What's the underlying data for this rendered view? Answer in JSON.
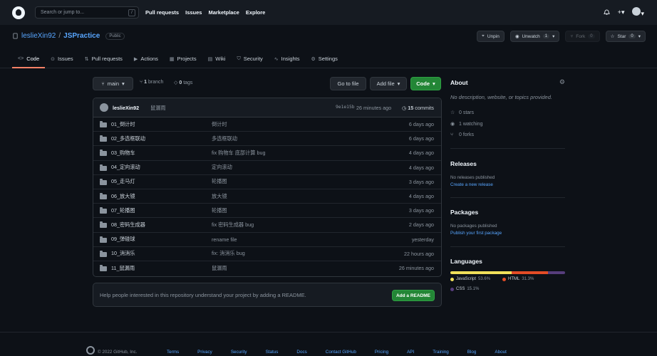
{
  "topbar": {
    "search_placeholder": "Search or jump to...",
    "search_key": "/",
    "nav": [
      "Pull requests",
      "Issues",
      "Marketplace",
      "Explore"
    ],
    "plus": "+",
    "chevron": "▾"
  },
  "repo": {
    "owner": "leslieXin92",
    "separator": "/",
    "name": "JSPractice",
    "visibility": "Public",
    "actions": {
      "unpin": "Unpin",
      "unwatch": "Unwatch",
      "unwatch_count": "1",
      "fork": "Fork",
      "fork_count": "0",
      "star": "Star",
      "star_count": "0"
    },
    "tabs": [
      "Code",
      "Issues",
      "Pull requests",
      "Actions",
      "Projects",
      "Wiki",
      "Security",
      "Insights",
      "Settings"
    ]
  },
  "controls": {
    "branch": "main",
    "branch_count": "1",
    "branch_label": "branch",
    "tags_count": "0",
    "tags_label": "tags",
    "go_to_file": "Go to file",
    "add_file": "Add file",
    "code": "Code"
  },
  "latest_commit": {
    "author": "leslieXin92",
    "message": "鼠漏雨",
    "hash": "9e1e15b",
    "time": "26 minutes ago",
    "commits_count": "15",
    "commits_label": "commits"
  },
  "files": [
    {
      "name": "01_倒计时",
      "message": "倒计时",
      "date": "6 days ago"
    },
    {
      "name": "02_多选框联动",
      "message": "多选框联动",
      "date": "6 days ago"
    },
    {
      "name": "03_购物车",
      "message": "fix 购物车 底部计算 bug",
      "date": "4 days ago"
    },
    {
      "name": "04_定向滚动",
      "message": "定向滚动",
      "date": "4 days ago"
    },
    {
      "name": "05_走马灯",
      "message": "轮播图",
      "date": "3 days ago"
    },
    {
      "name": "06_放大镜",
      "message": "放大镜",
      "date": "4 days ago"
    },
    {
      "name": "07_轮播图",
      "message": "轮播图",
      "date": "3 days ago"
    },
    {
      "name": "08_密码生成器",
      "message": "fix 密码生成器 bug",
      "date": "2 days ago"
    },
    {
      "name": "09_弹碰球",
      "message": "rename file",
      "date": "yesterday"
    },
    {
      "name": "10_消消乐",
      "message": "fix: 消消乐 bug",
      "date": "22 hours ago"
    },
    {
      "name": "11_鼠漏雨",
      "message": "鼠漏雨",
      "date": "26 minutes ago"
    }
  ],
  "readme": {
    "text": "Help people interested in this repository understand your project by adding a README.",
    "button": "Add a README"
  },
  "sidebar": {
    "about_title": "About",
    "description": "No description, website, or topics provided.",
    "stars": "0 stars",
    "watching": "1 watching",
    "forks": "0 forks",
    "releases_title": "Releases",
    "releases_text": "No releases published",
    "releases_link": "Create a new release",
    "packages_title": "Packages",
    "packages_text": "No packages published",
    "packages_link": "Publish your first package",
    "languages_title": "Languages",
    "languages": [
      {
        "name": "JavaScript",
        "percent": "53.6%",
        "value": 53.6,
        "color": "#f1e05a"
      },
      {
        "name": "HTML",
        "percent": "31.3%",
        "value": 31.3,
        "color": "#e34c26"
      },
      {
        "name": "CSS",
        "percent": "15.1%",
        "value": 15.1,
        "color": "#563d7c"
      }
    ]
  },
  "footer": {
    "copyright": "© 2022 GitHub, Inc.",
    "links": [
      "Terms",
      "Privacy",
      "Security",
      "Status",
      "Docs",
      "Contact GitHub",
      "Pricing",
      "API",
      "Training",
      "Blog",
      "About"
    ]
  }
}
